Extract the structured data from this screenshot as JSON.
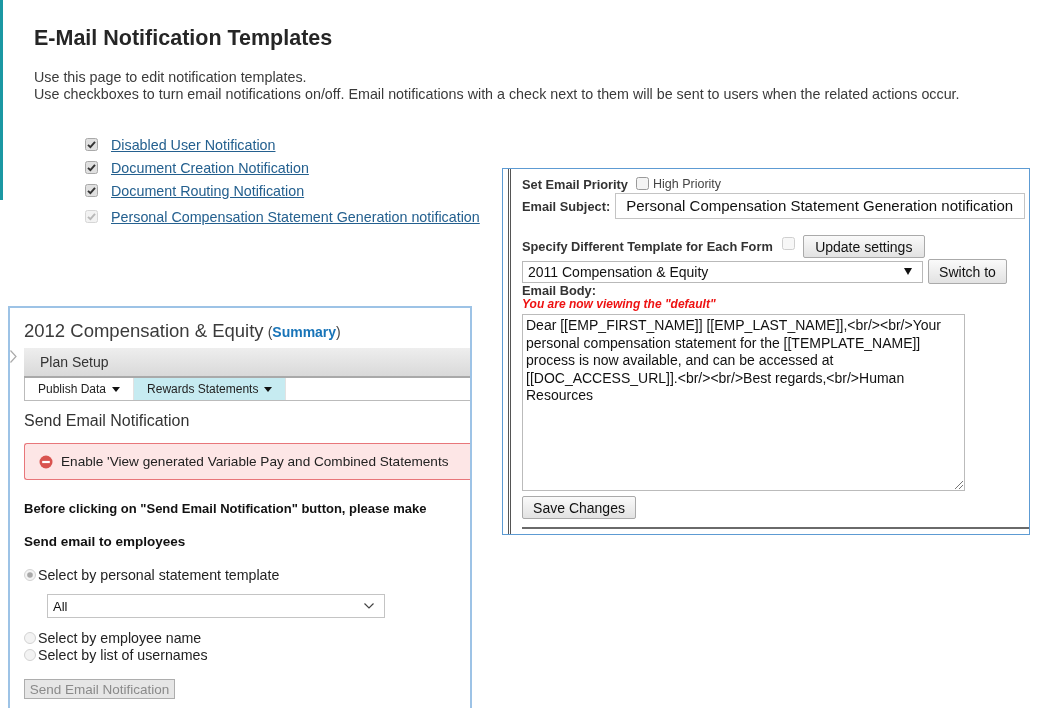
{
  "page": {
    "title": "E-Mail Notification Templates",
    "intro": [
      "Use this page to edit notification templates.",
      "Use checkboxes to turn email notifications on/off. Email notifications with a check next to them will be sent to users when the related actions occur."
    ]
  },
  "notifications": [
    {
      "label": "Disabled User Notification",
      "checked": true,
      "disabled": false
    },
    {
      "label": "Document Creation Notification",
      "checked": true,
      "disabled": false
    },
    {
      "label": "Document Routing Notification",
      "checked": true,
      "disabled": false
    },
    {
      "label": "Personal Compensation Statement Generation notification",
      "checked": true,
      "disabled": true
    }
  ],
  "template_editor": {
    "priority_label": "Set Email Priority",
    "high_priority": {
      "label": "High Priority",
      "checked": false
    },
    "subject_label": "Email Subject:",
    "subject": "Personal Compensation Statement Generation notification",
    "per_form": {
      "label": "Specify Different Template for Each Form",
      "checked": false,
      "disabled": true
    },
    "update_button": "Update settings",
    "form_select": "2011 Compensation & Equity",
    "switch_button": "Switch to",
    "body_label": "Email Body:",
    "viewing_note": "You are now viewing the \"default\"",
    "body": "Dear [[EMP_FIRST_NAME]] [[EMP_LAST_NAME]],<br/><br/>Your personal compensation statement for the [[TEMPLATE_NAME]] process is now available, and can be accessed at [[DOC_ACCESS_URL]].<br/><br/>Best regards,<br/>Human Resources",
    "save_button": "Save Changes"
  },
  "plan_panel": {
    "title": "2012 Compensation & Equity",
    "summary_link": "(**Summary**)",
    "menu_bar": "Plan Setup",
    "tabs": [
      {
        "label": "Publish Data",
        "selected": false
      },
      {
        "label": "Rewards Statements",
        "selected": true
      }
    ],
    "section_title": "Send Email Notification",
    "alert": {
      "kind": "error",
      "text": "Enable 'View generated Variable Pay and Combined Statements"
    },
    "instruction": "Before clicking on \"Send Email Notification\" button, please make",
    "recipients_heading": "Send email to employees",
    "recipient_options": [
      {
        "label": "Select by personal statement template",
        "selected": true,
        "dropdown": "All"
      },
      {
        "label": "Select by employee name",
        "selected": false
      },
      {
        "label": "Select by list of usernames",
        "selected": false
      }
    ],
    "send_button": {
      "label": "Send Email Notification",
      "disabled": true
    }
  }
}
